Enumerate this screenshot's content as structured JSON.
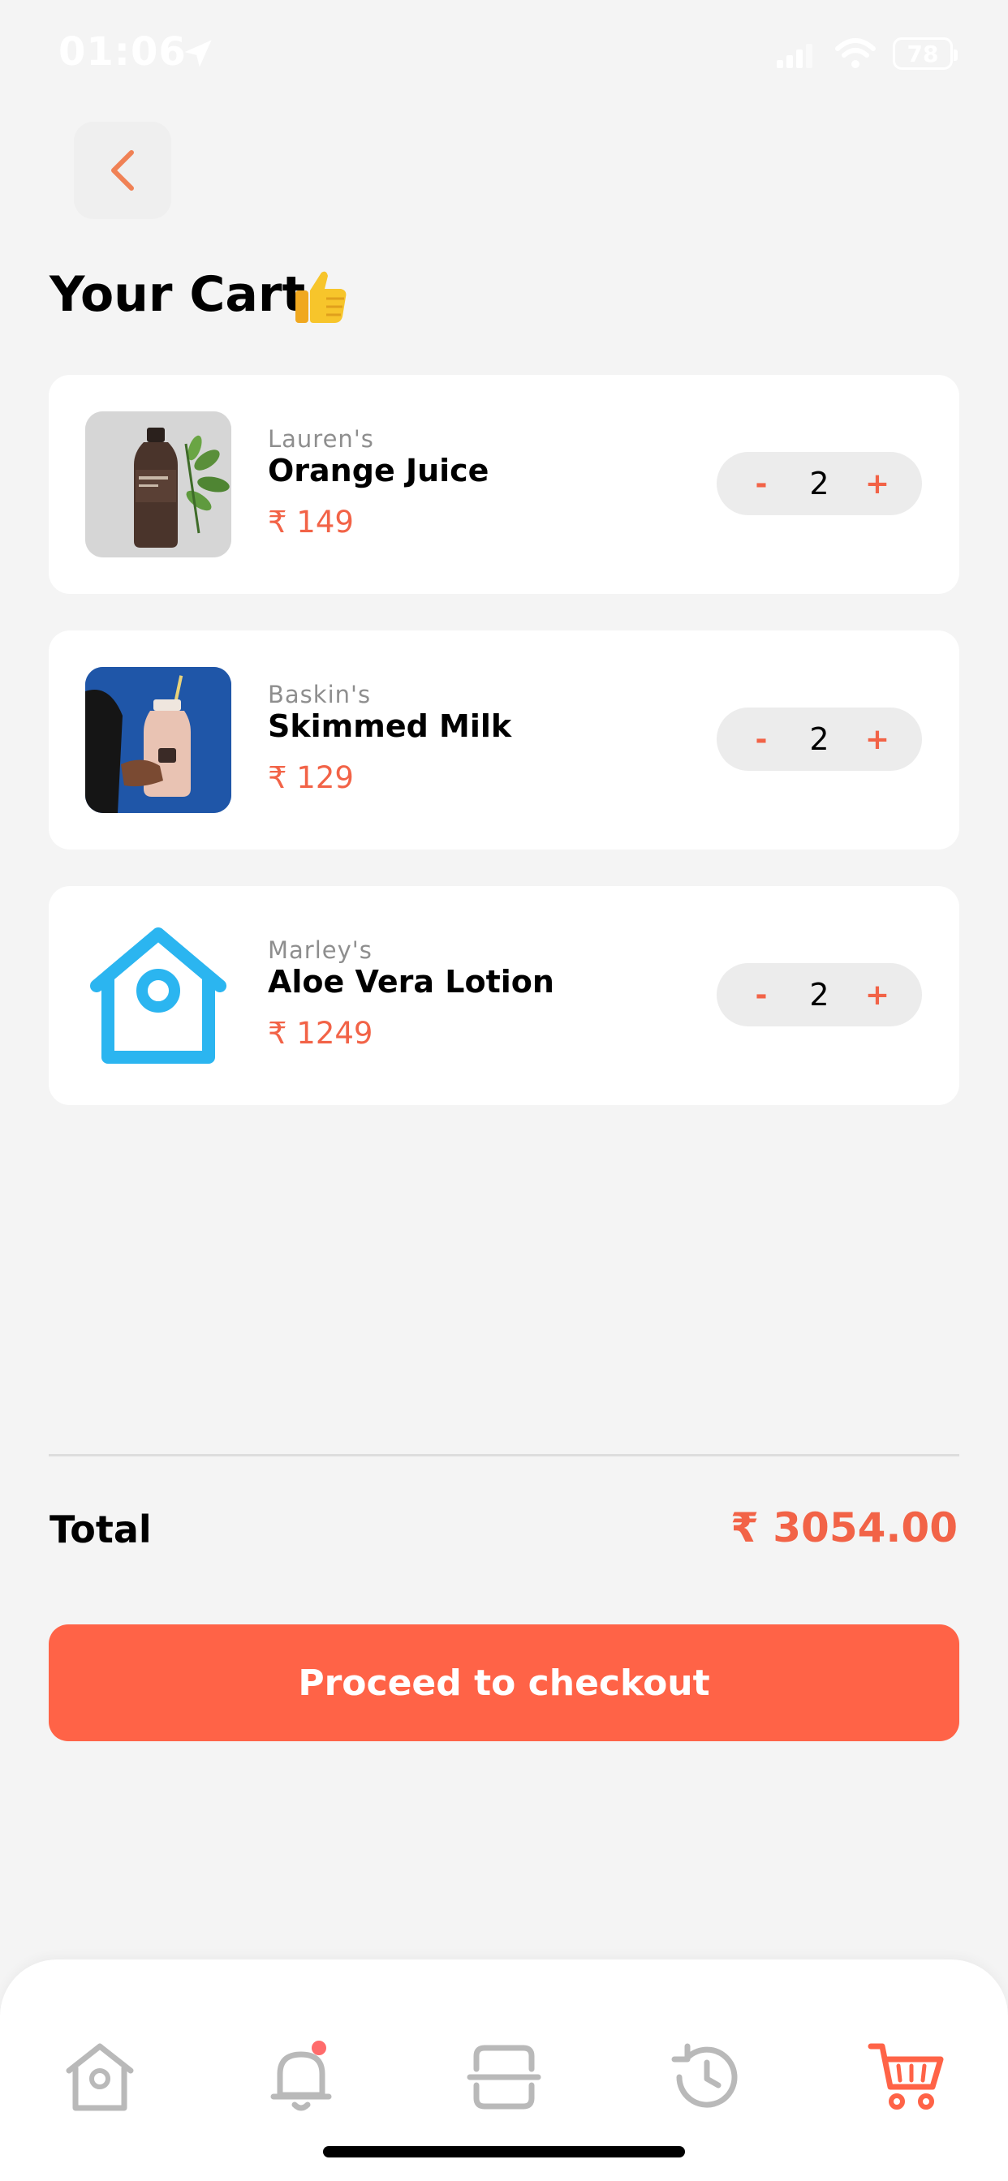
{
  "status_bar": {
    "time": "01:06",
    "battery": "78"
  },
  "page": {
    "title": "Your Cart"
  },
  "cart": {
    "items": [
      {
        "brand": "Lauren's",
        "name": "Orange Juice",
        "price": "₹ 149",
        "qty": "2",
        "minus": "-",
        "plus": "+"
      },
      {
        "brand": "Baskin's",
        "name": "Skimmed Milk",
        "price": "₹ 129",
        "qty": "2",
        "minus": "-",
        "plus": "+"
      },
      {
        "brand": "Marley's",
        "name": "Aloe Vera Lotion",
        "price": "₹ 1249",
        "qty": "2",
        "minus": "-",
        "plus": "+"
      }
    ]
  },
  "summary": {
    "total_label": "Total",
    "total_value": "₹ 3054.00"
  },
  "checkout": {
    "label": "Proceed to checkout"
  },
  "nav": {
    "items": [
      {
        "icon": "home-icon"
      },
      {
        "icon": "bell-icon"
      },
      {
        "icon": "scan-icon"
      },
      {
        "icon": "history-icon"
      },
      {
        "icon": "cart-icon",
        "active": true
      }
    ]
  },
  "colors": {
    "accent": "#ff6347",
    "price": "#f26347",
    "background": "#f4f4f4",
    "card": "#ffffff",
    "nav_inactive": "#b9b9b9",
    "lotion_icon": "#2bb5f0"
  }
}
